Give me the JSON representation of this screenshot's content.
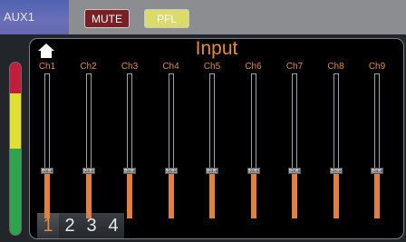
{
  "header": {
    "aux_label": "AUX1",
    "mute_label": "MUTE",
    "pfl_label": "PFL"
  },
  "panel": {
    "title": "Input",
    "channels": [
      {
        "label": "Ch1",
        "value": "-24.0",
        "level": 0.33
      },
      {
        "label": "Ch2",
        "value": "-24.0",
        "level": 0.33
      },
      {
        "label": "Ch3",
        "value": "-24.0",
        "level": 0.33
      },
      {
        "label": "Ch4",
        "value": "-24.0",
        "level": 0.33
      },
      {
        "label": "Ch5",
        "value": "-24.0",
        "level": 0.33
      },
      {
        "label": "Ch6",
        "value": "-24.0",
        "level": 0.33
      },
      {
        "label": "Ch7",
        "value": "-24.0",
        "level": 0.33
      },
      {
        "label": "Ch8",
        "value": "-24.0",
        "level": 0.33
      },
      {
        "label": "Ch9",
        "value": "-24.0",
        "level": 0.33
      }
    ],
    "pages": [
      "1",
      "2",
      "3",
      "4"
    ],
    "active_page": "1"
  },
  "colors": {
    "accent": "#e28a3d",
    "mute": "#7a1f24",
    "pfl": "#dadb6a",
    "aux_tab": "#5a66b3"
  },
  "icons": {
    "home": "home-icon"
  }
}
